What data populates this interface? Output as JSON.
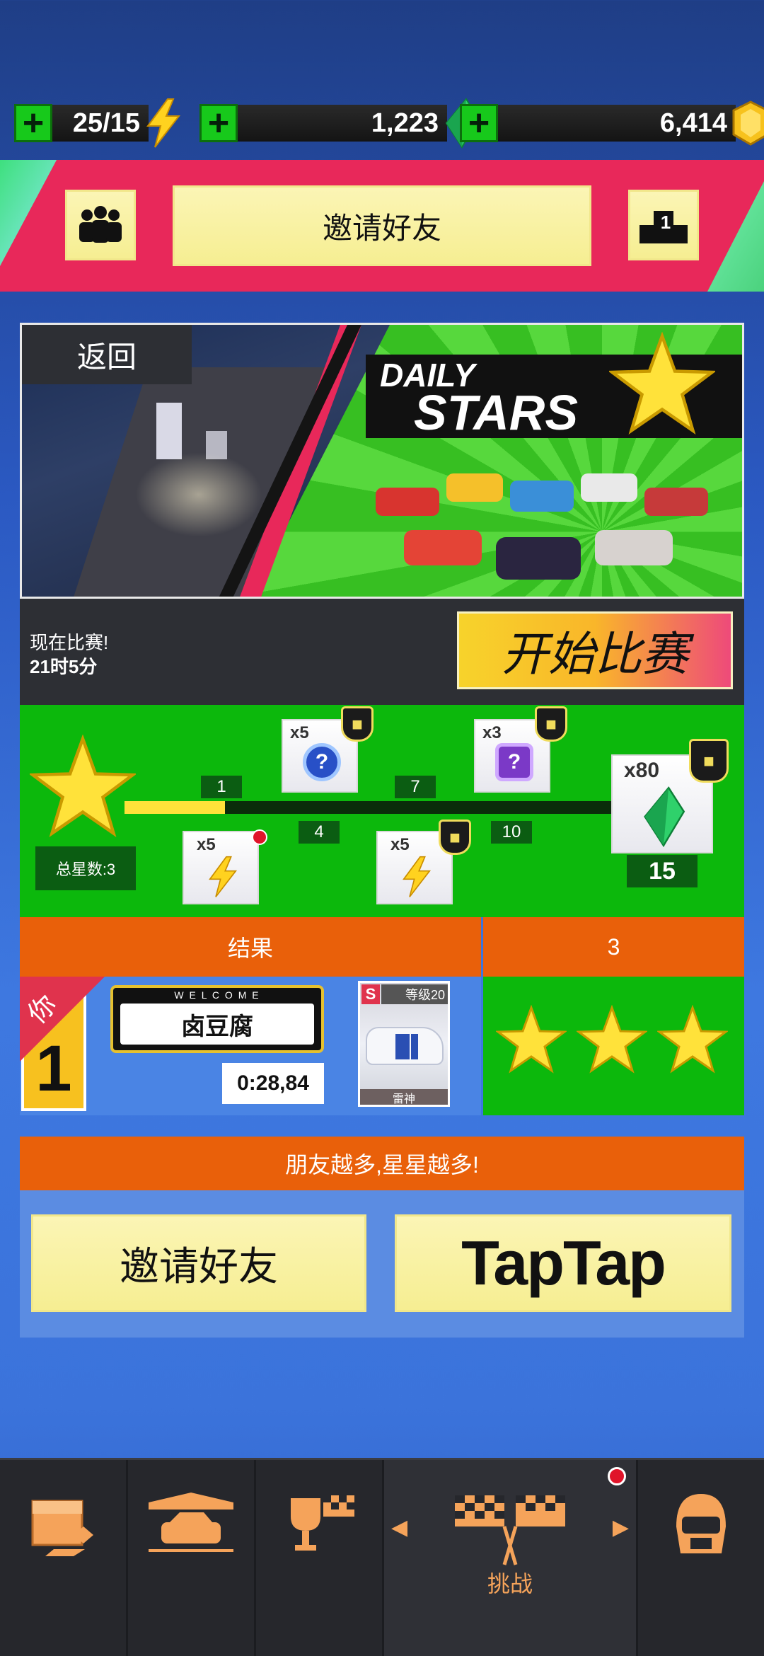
{
  "currency": {
    "energy": "25/15",
    "gems": "1,223",
    "coins": "6,414"
  },
  "banner": {
    "invite_label": "邀请好友",
    "rank": "1"
  },
  "event": {
    "back_label": "返回",
    "title_line1": "DAILY",
    "title_line2": "STARS",
    "race_now": "现在比赛!",
    "time_left": "21时5分",
    "start_label": "开始比赛"
  },
  "progress": {
    "total_stars_label": "总星数:3",
    "milestones_top": [
      "1",
      "7"
    ],
    "milestones_bottom": [
      "4",
      "10"
    ],
    "final": "15",
    "rewards": {
      "mystery_blue": "x5",
      "mystery_purple": "x3",
      "energy_1": "x5",
      "energy_2": "x5",
      "gems": "x80"
    },
    "fill_fraction": 0.2
  },
  "results": {
    "header_label": "结果",
    "header_stars": "3",
    "ribbon": "你",
    "rank": "1",
    "plate_top": "W E L C O M E",
    "player_name": "卤豆腐",
    "time": "0:28,84",
    "car_class": "S",
    "car_level": "等级20",
    "car_name": "雷神",
    "stars": 3
  },
  "friends": {
    "banner": "朋友越多,星星越多!",
    "invite_label": "邀请好友",
    "taptap_label": "TapTap"
  },
  "nav": {
    "active_label": "挑战"
  },
  "colors": {
    "pink": "#e8285a",
    "green": "#0cb80c",
    "orange": "#e9600a",
    "yellow_button": "#f6ee92"
  }
}
